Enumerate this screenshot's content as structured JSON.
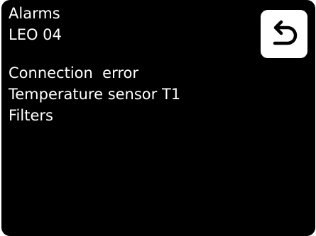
{
  "header": {
    "title": "Alarms",
    "subtitle": "LEO 04"
  },
  "alarms": [
    "Connection  error",
    "Temperature sensor T1",
    "Filters"
  ],
  "back_button": {
    "icon": "back-arrow-icon"
  },
  "colors": {
    "background": "#000000",
    "text": "#ffffff",
    "button": "#ffffff",
    "icon": "#000000"
  }
}
